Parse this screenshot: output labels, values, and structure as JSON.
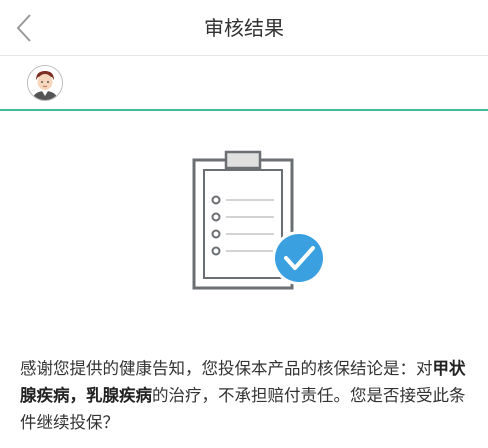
{
  "nav": {
    "title": "审核结果"
  },
  "message": {
    "line_intro": "感谢您提供的健康告知，您投保本产品的核保结论是：对",
    "disease1": "甲状腺疾病",
    "sep": "，",
    "disease2": "乳腺疾病",
    "line_rest": "的治疗，不承担赔付责任。您是否接受此条件继续投保？"
  },
  "colors": {
    "accent": "#3fb99a",
    "check_badge": "#3aa0e0",
    "clipboard": "#6b6f73"
  },
  "icons": [
    "back-chevron-icon",
    "avatar-icon",
    "clipboard-icon",
    "check-badge-icon"
  ]
}
